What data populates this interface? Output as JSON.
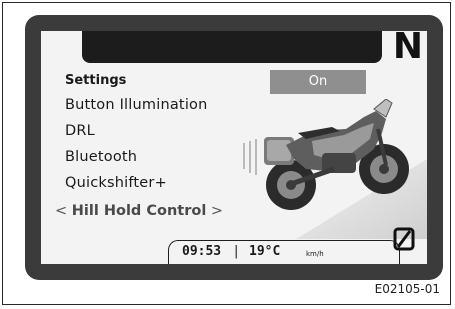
{
  "display": {
    "gear": "N",
    "menu": {
      "title": "Settings",
      "items": [
        {
          "label": "Button Illumination"
        },
        {
          "label": "DRL"
        },
        {
          "label": "Bluetooth"
        },
        {
          "label": "Quickshifter+"
        }
      ],
      "selected": {
        "arrow_left": "<",
        "label": "Hill Hold Control",
        "arrow_right": ">"
      }
    },
    "value_box": "On",
    "status": {
      "time": "09:53",
      "separator": "|",
      "temperature": "19°C",
      "speed_unit": "km/h"
    },
    "icons": {
      "bike": "motorcycle-illustration",
      "zero": "zero-slash-icon"
    }
  },
  "figure_code": "E02105-01",
  "colors": {
    "bezel": "#3b3b3b",
    "screen": "#f3f3f3",
    "value_box": "#8f8f8f",
    "topbar": "#1c1c1c"
  }
}
